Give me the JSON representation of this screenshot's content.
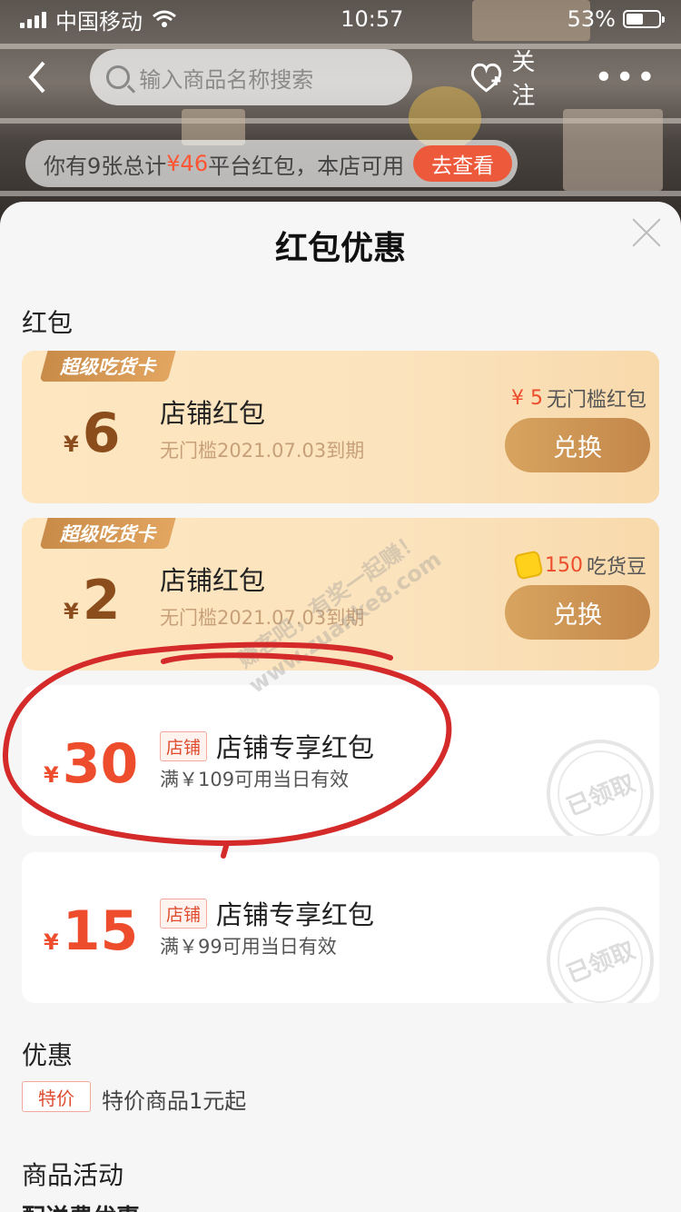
{
  "status_bar": {
    "carrier": "中国移动",
    "time": "10:57",
    "battery": "53%"
  },
  "topbar": {
    "search_placeholder": "输入商品名称搜索",
    "follow_label": "关注",
    "more_label": "•••"
  },
  "notice": {
    "prefix": "你有9张总计",
    "amount": "¥46",
    "suffix": "平台红包，本店可用",
    "action": "去查看"
  },
  "sheet": {
    "title": "红包优惠"
  },
  "sections": {
    "red_packets": "红包",
    "discounts": "优惠",
    "activities": "商品活动",
    "delivery": "配送费优惠"
  },
  "gold_cards": [
    {
      "ribbon": "超级吃货卡",
      "currency": "¥",
      "amount": "6",
      "title": "店铺红包",
      "subtitle": "无门槛2021.07.03到期",
      "note_red": "¥ 5",
      "note": "无门槛红包",
      "button": "兑换"
    },
    {
      "ribbon": "超级吃货卡",
      "currency": "¥",
      "amount": "2",
      "title": "店铺红包",
      "subtitle": "无门槛2021.07.03到期",
      "note_red": "150",
      "note": "吃货豆",
      "button": "兑换"
    }
  ],
  "shop_cards": [
    {
      "currency": "¥",
      "amount": "30",
      "tag": "店铺",
      "title": "店铺专享红包",
      "subtitle": "满￥109可用当日有效",
      "stamp": "已领取"
    },
    {
      "currency": "¥",
      "amount": "15",
      "tag": "店铺",
      "title": "店铺专享红包",
      "subtitle": "满￥99可用当日有效",
      "stamp": "已领取"
    }
  ],
  "promo": {
    "tag": "特价",
    "text": "特价商品1元起"
  },
  "watermark": {
    "line1": "赚客吧，有奖一起赚！",
    "line2": "www.zuanke8.com"
  },
  "colors": {
    "accent": "#ee4d2d",
    "gold_button": "#c98b48",
    "annotation": "#d42a2a"
  }
}
